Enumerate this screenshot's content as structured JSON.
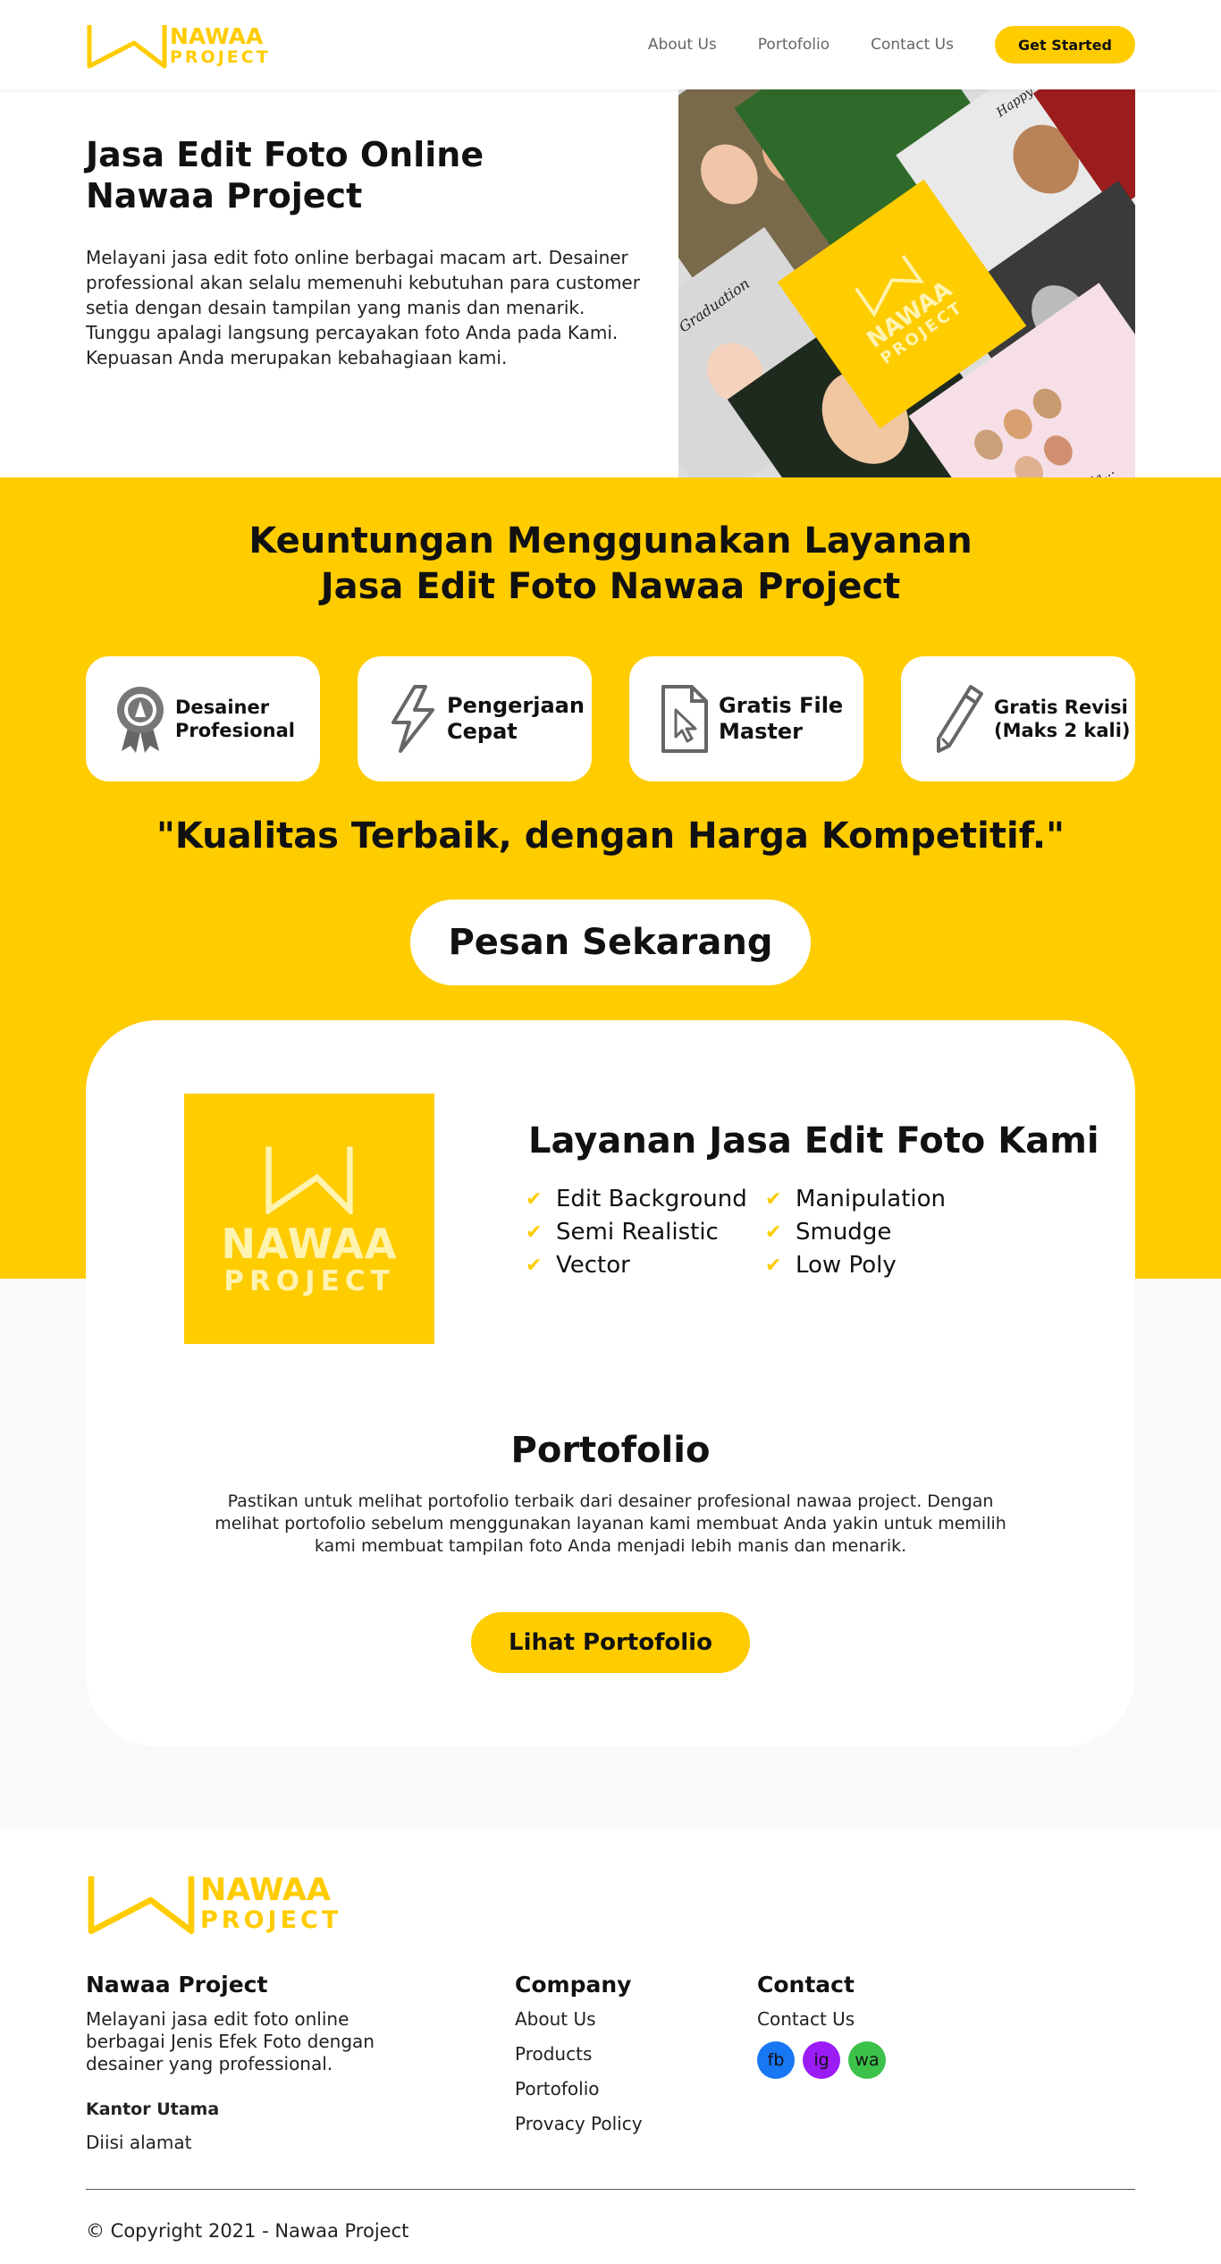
{
  "brand": {
    "word1": "NAWAA",
    "word2": "PROJECT",
    "color": "#ffcc00"
  },
  "nav": {
    "items": [
      "About Us",
      "Portofolio",
      "Contact Us"
    ],
    "cta": "Get Started"
  },
  "hero": {
    "title": "Jasa Edit Foto Online Nawaa Project",
    "description": "Melayani jasa edit foto online berbagai macam art. Desainer professional akan selalu memenuhi kebutuhan para customer setia dengan desain tampilan yang manis dan menarik. Tunggu apalagi langsung percayakan foto Anda pada Kami. Kepuasan Anda merupakan kebahagiaan kami.",
    "collage": {
      "grad1": "Happy Graduation",
      "grad2": "Happy Graduation",
      "caption": "Happy Ma..."
    }
  },
  "benefits": {
    "title_line1": "Keuntungan Menggunakan Layanan",
    "title_line2": "Jasa Edit Foto Nawaa Project",
    "features": [
      {
        "label": "Desainer\nProfesional",
        "icon": "award-icon"
      },
      {
        "label": "Pengerjaan\nCepat",
        "icon": "lightning-icon"
      },
      {
        "label": "Gratis File\nMaster",
        "icon": "file-cursor-icon"
      },
      {
        "label": "Gratis Revisi\n(Maks 2 kali)",
        "icon": "pencil-icon"
      }
    ],
    "quote": "\"Kualitas Terbaik, dengan Harga Kompetitif.\"",
    "order_button": "Pesan Sekarang"
  },
  "services": {
    "title": "Layanan Jasa Edit Foto Kami",
    "col1": [
      "Edit Background",
      "Semi Realistic",
      "Vector"
    ],
    "col2": [
      "Manipulation",
      "Smudge",
      "Low Poly"
    ]
  },
  "portfolio": {
    "title": "Portofolio",
    "text": "Pastikan untuk melihat portofolio terbaik dari desainer profesional nawaa project. Dengan melihat portofolio sebelum menggunakan layanan kami membuat Anda yakin untuk memilih kami membuat tampilan foto Anda menjadi lebih manis dan menarik.",
    "button": "Lihat Portofolio"
  },
  "footer": {
    "about": {
      "title": "Nawaa Project",
      "text": "Melayani jasa edit foto online berbagai Jenis Efek Foto dengan desainer yang professional.",
      "office_title": "Kantor Utama",
      "office_value": "Diisi alamat"
    },
    "company": {
      "title": "Company",
      "links": [
        "About Us",
        "Products",
        "Portofolio",
        "Provacy Policy"
      ]
    },
    "contact": {
      "title": "Contact",
      "link": "Contact Us",
      "socials": [
        {
          "label": "fb",
          "color": "#1877f2"
        },
        {
          "label": "ig",
          "color": "#9b1cf5"
        },
        {
          "label": "wa",
          "color": "#3cc24a"
        }
      ]
    },
    "copyright": "© Copyright 2021 - Nawaa Project"
  }
}
